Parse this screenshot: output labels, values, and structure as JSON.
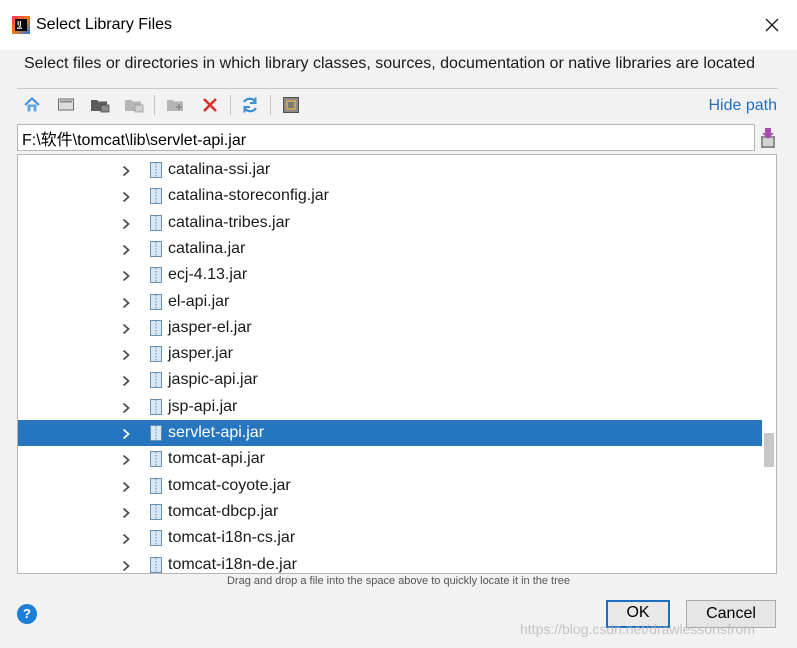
{
  "window": {
    "title": "Select Library Files",
    "description": "Select files or directories in which library classes, sources, documentation or native libraries are located"
  },
  "toolbar": {
    "buttons": [
      {
        "name": "home-icon"
      },
      {
        "name": "desktop-icon"
      },
      {
        "name": "project-folder-icon"
      },
      {
        "name": "module-folder-icon"
      },
      {
        "name": "new-folder-icon"
      },
      {
        "name": "delete-icon"
      },
      {
        "name": "refresh-icon"
      },
      {
        "name": "show-hidden-icon"
      }
    ],
    "hide_path_label": "Hide path"
  },
  "path_field": {
    "value": "F:\\软件\\tomcat\\lib\\servlet-api.jar"
  },
  "tree": {
    "items": [
      {
        "label": "catalina-ssi.jar",
        "selected": false
      },
      {
        "label": "catalina-storeconfig.jar",
        "selected": false
      },
      {
        "label": "catalina-tribes.jar",
        "selected": false
      },
      {
        "label": "catalina.jar",
        "selected": false
      },
      {
        "label": "ecj-4.13.jar",
        "selected": false
      },
      {
        "label": "el-api.jar",
        "selected": false
      },
      {
        "label": "jasper-el.jar",
        "selected": false
      },
      {
        "label": "jasper.jar",
        "selected": false
      },
      {
        "label": "jaspic-api.jar",
        "selected": false
      },
      {
        "label": "jsp-api.jar",
        "selected": false
      },
      {
        "label": "servlet-api.jar",
        "selected": true
      },
      {
        "label": "tomcat-api.jar",
        "selected": false
      },
      {
        "label": "tomcat-coyote.jar",
        "selected": false
      },
      {
        "label": "tomcat-dbcp.jar",
        "selected": false
      },
      {
        "label": "tomcat-i18n-cs.jar",
        "selected": false
      },
      {
        "label": "tomcat-i18n-de.jar",
        "selected": false
      }
    ]
  },
  "hint": "Drag and drop a file into the space above to quickly locate it in the tree",
  "buttons": {
    "ok_label": "OK",
    "cancel_label": "Cancel",
    "help_label": "?"
  },
  "watermark": "https://blog.csdn.net/drawlessonsfrom",
  "colors": {
    "selection": "#2675bf",
    "link": "#2470c0",
    "delete": "#d93025",
    "help": "#1e7fd6"
  }
}
